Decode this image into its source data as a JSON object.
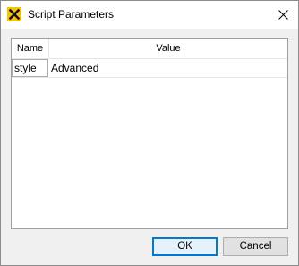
{
  "window": {
    "title": "Script Parameters",
    "app_icon": "yellow-x-app-icon",
    "close_icon": "close-icon"
  },
  "grid": {
    "columns": [
      "Name",
      "Value"
    ],
    "rows": [
      {
        "name": "style",
        "value": "Advanced"
      }
    ]
  },
  "buttons": {
    "ok_label": "OK",
    "cancel_label": "Cancel"
  },
  "colors": {
    "accent": "#0078d7",
    "icon_bg": "#f5c400"
  }
}
